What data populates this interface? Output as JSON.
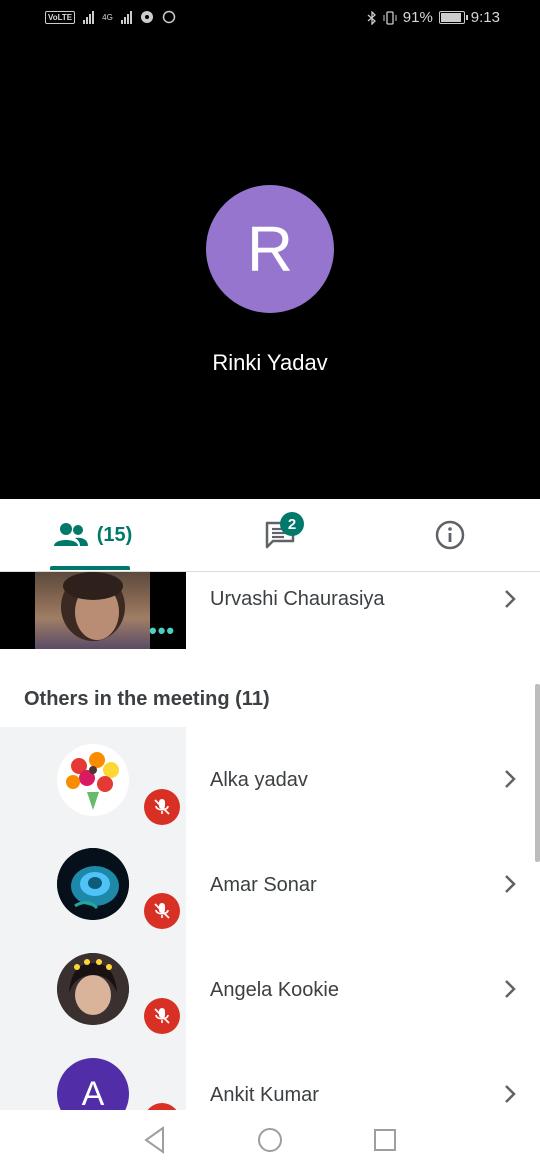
{
  "status_bar": {
    "volte": "VoLTE",
    "network": "4G",
    "battery_pct": "91%",
    "time": "9:13",
    "battery_level": 0.91
  },
  "call": {
    "avatar_letter": "R",
    "avatar_color": "#9575cd",
    "participant_name": "Rinki Yadav"
  },
  "tabs": {
    "people_count": "(15)",
    "chat_badge": "2",
    "accent_color": "#00796b"
  },
  "participants": {
    "pinned": {
      "name": "Urvashi Chaurasiya"
    },
    "others_header": "Others in the meeting (11)",
    "others": [
      {
        "name": "Alka yadav",
        "muted": true
      },
      {
        "name": "Amar Sonar",
        "muted": true
      },
      {
        "name": "Angela Kookie",
        "muted": true
      },
      {
        "name": "Ankit Kumar",
        "avatar_letter": "A",
        "avatar_color": "#512da8",
        "muted": true
      }
    ]
  },
  "icons": {
    "people_tab": "people-icon",
    "chat_tab": "chat-icon",
    "info_tab": "info-icon",
    "row_action": "chevron-right-icon",
    "mute": "mic-off-icon",
    "nav": [
      "back-icon",
      "home-icon",
      "recents-icon"
    ]
  }
}
